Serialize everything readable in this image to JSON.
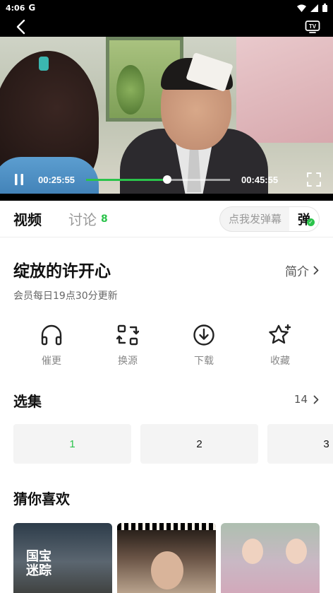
{
  "status_bar": {
    "time": "4:06",
    "g_label": "G"
  },
  "player": {
    "current_time": "00:25:55",
    "total_time": "00:45:55",
    "progress_fraction": 0.5648,
    "accent_color": "#2bc34b"
  },
  "tabs": {
    "video": "视频",
    "discuss": "讨论",
    "discuss_count": "8",
    "danmu_placeholder": "点我发弹幕",
    "danmu_toggle": "弹"
  },
  "show": {
    "title": "绽放的许开心",
    "intro_label": "简介",
    "update_info": "会员每日19点30分更新"
  },
  "actions": [
    {
      "label": "催更",
      "icon": "headphones-icon"
    },
    {
      "label": "换源",
      "icon": "switch-source-icon"
    },
    {
      "label": "下载",
      "icon": "download-icon"
    },
    {
      "label": "收藏",
      "icon": "star-icon"
    }
  ],
  "episodes": {
    "title": "选集",
    "count": "14",
    "items": [
      "1",
      "2",
      "3"
    ],
    "active_index": 0
  },
  "recommend": {
    "title": "猜你喜欢",
    "posters": [
      {
        "text": "国宝\n迷踪"
      },
      {
        "text": ""
      },
      {
        "text": ""
      }
    ]
  }
}
